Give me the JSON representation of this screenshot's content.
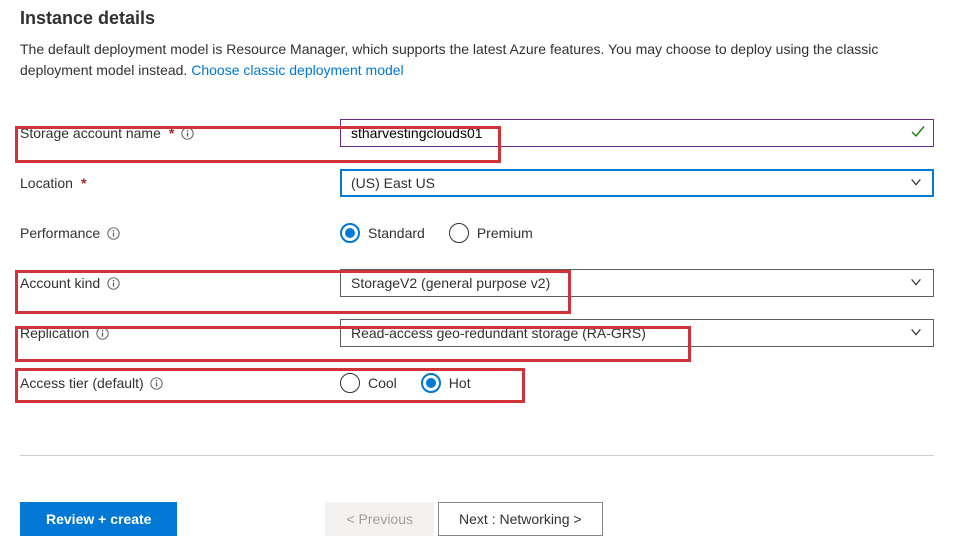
{
  "section_title": "Instance details",
  "description": {
    "text": "The default deployment model is Resource Manager, which supports the latest Azure features. You may choose to deploy using the classic deployment model instead.  ",
    "link_text": "Choose classic deployment model"
  },
  "fields": {
    "storage_account_name": {
      "label": "Storage account name",
      "required": true,
      "info": true,
      "value": "stharvestingclouds01",
      "valid": true
    },
    "location": {
      "label": "Location",
      "required": true,
      "info": false,
      "value": "(US) East US"
    },
    "performance": {
      "label": "Performance",
      "info": true,
      "options": [
        "Standard",
        "Premium"
      ],
      "selected": "Standard"
    },
    "account_kind": {
      "label": "Account kind",
      "info": true,
      "value": "StorageV2 (general purpose v2)"
    },
    "replication": {
      "label": "Replication",
      "info": true,
      "value": "Read-access geo-redundant storage (RA-GRS)"
    },
    "access_tier": {
      "label": "Access tier (default)",
      "info": true,
      "options": [
        "Cool",
        "Hot"
      ],
      "selected": "Hot"
    }
  },
  "footer": {
    "review_create": "Review + create",
    "previous": "< Previous",
    "next": "Next : Networking >"
  }
}
